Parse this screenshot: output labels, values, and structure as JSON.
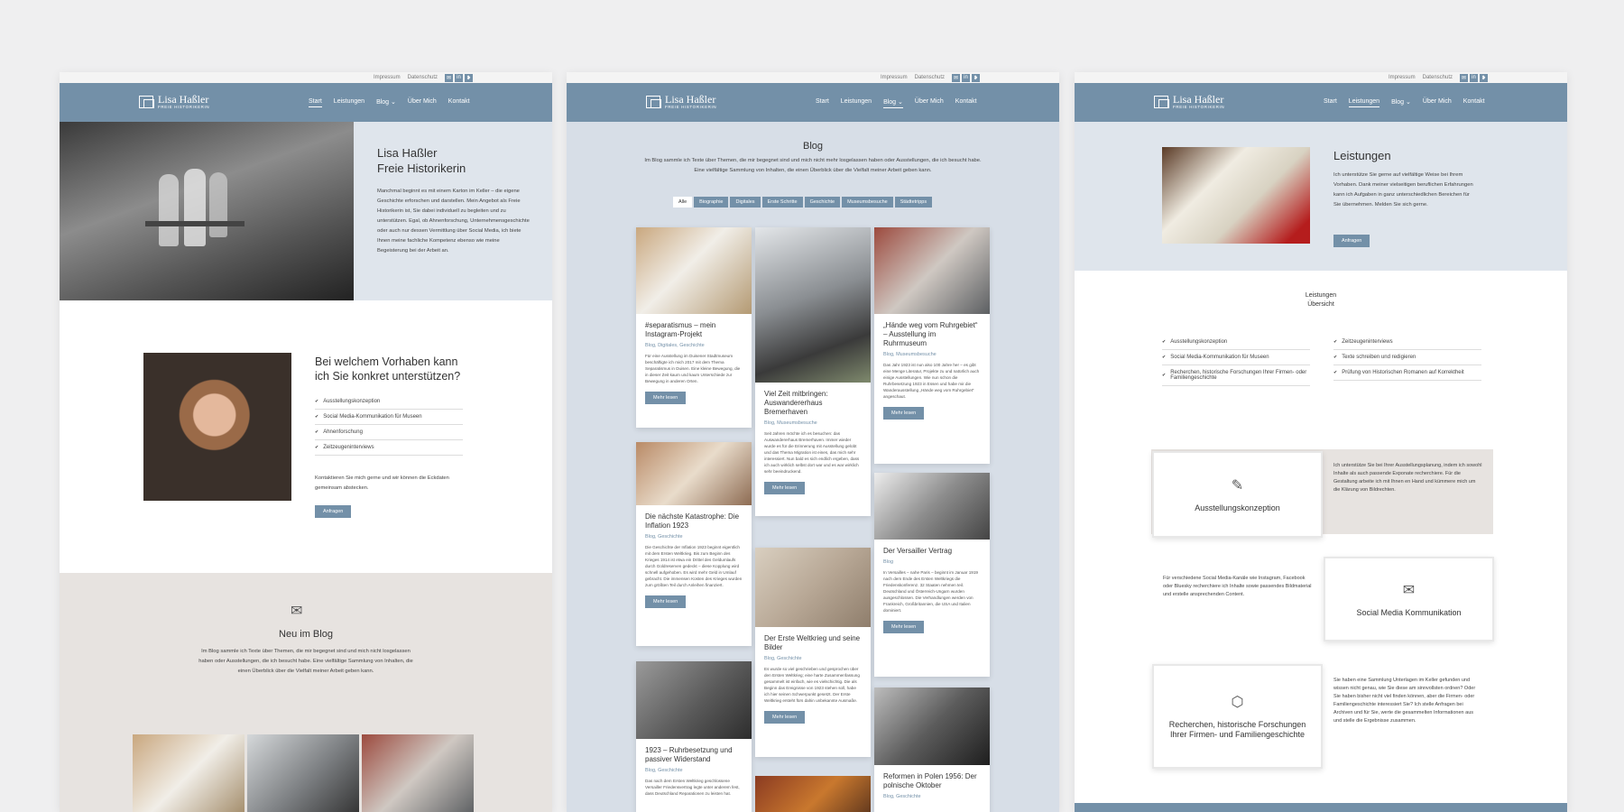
{
  "site": {
    "util": [
      "Impressum",
      "Datenschutz"
    ],
    "social": [
      "✉",
      "in",
      "❥"
    ],
    "logo_name": "Lisa Haßler",
    "logo_sub": "FREIE HISTORIKERIN",
    "menu": [
      "Start",
      "Leistungen",
      "Blog ⌄",
      "Über Mich",
      "Kontakt"
    ]
  },
  "start": {
    "hero_title1": "Lisa Haßler",
    "hero_title2": "Freie Historikerin",
    "hero_text": "Manchmal beginnt es mit einem Karton im Keller – die eigene Geschichte erforschen und darstellen. Mein Angebot als Freie Historikerin ist, Sie dabei individuell zu begleiten und zu unterstützen. Egal, ob Ahnenforschung, Unternehmensgeschichte oder auch nur dessen Vermittlung über Social Media, ich biete Ihnen meine fachliche Kompetenz ebenso wie meine Begeisterung bei der Arbeit an.",
    "q_title": "Bei welchem Vorhaben kann ich Sie konkret unterstützen?",
    "list": [
      "Ausstellungskonzeption",
      "Social Media-Kommunikation für Museen",
      "Ahnenforschung",
      "Zeitzeugeninterviews"
    ],
    "contact_text": "Kontaktieren Sie mich gerne und wir können die Eckdaten gemeinsam abstecken.",
    "btn": "Anfragen",
    "blog_title": "Neu im Blog",
    "blog_text": "Im Blog sammle ich Texte über Themen, die mir begegnet sind und mich nicht losgelassen haben oder Ausstellungen, die ich besucht habe. Eine vielfältige Sammlung von Inhalten, die einen Überblick über die Vielfalt meiner Arbeit geben kann."
  },
  "blog": {
    "title": "Blog",
    "intro": "Im Blog sammle ich Texte über Themen, die mir begegnet sind und mich nicht mehr losgelassen haben oder Ausstellungen, die ich besucht habe. Eine vielfältige Sammlung von Inhalten, die einen Überblick über die Vielfalt meiner Arbeit geben kann.",
    "filters": [
      "Alle",
      "Biographie",
      "Digitales",
      "Erste Schritte",
      "Geschichte",
      "Museumsbesuche",
      "Städtetripps"
    ],
    "more": "Mehr lesen",
    "cards": [
      {
        "title": "#separatismus – mein Instagram-Projekt",
        "cat": "Blog, Digitales, Geschichte",
        "text": "Für eine Ausstellung im Duisener Stadtmuseum beschäftigte ich mich 2017 mit dem Thema Separatismus in Duisen. Eine kleine Bewegung, die in dieser Zeit kaum und kaum Unterschiede zur Bewegung in anderen Orten."
      },
      {
        "title": "Die nächste Katastrophe: Die Inflation 1923",
        "cat": "Blog, Geschichte",
        "text": "Die Geschichte der Inflation 1923 beginnt eigentlich mit dem Ersten Weltkrieg. Bis zum Beginn des Krieges 1914 ist etwa ein Drittel des Geldumlaufs durch Goldreserven gedeckt – diese Kopplung wird schnell aufgehoben. Es wird mehr Geld in Umlauf gebracht. Die immensen Kosten des Krieges wurden zum größten Teil durch Anleihen finanziert."
      },
      {
        "title": "1923 – Ruhrbesetzung und passiver Widerstand",
        "cat": "Blog, Geschichte",
        "text": "Das nach dem Ersten Weltkrieg geschlossene Versailler Friedensvertrag legte unter anderem fest, dass Deutschland Reparationen zu leisten hat."
      },
      {
        "title": "Viel Zeit mitbringen: Auswandererhaus Bremerhaven",
        "cat": "Blog, Museumsbesuche",
        "text": "Seit Jahren möchte ich es besuchen: das Auswandererhaus Bremerhaven. Immer wieder wurde es für die Erinnerung mit Ausstellung gelobt und das Thema Migration ist eines, das mich sehr interessiert. Nun bald es sich endlich ergeben, dass ich auch wirklich selbst dort war und es war wirklich sehr beeindruckend."
      },
      {
        "title": "Der Erste Weltkrieg und seine Bilder",
        "cat": "Blog, Geschichte",
        "text": "Es wurde so viel geschrieben und gesprochen über den Ersten Weltkrieg; eine harte Zusammenfassung gesammelt ist einfach, wie es vielschichtig. Die als Beginn das Ereignisse von 1923 stehen soll, habe ich hier seinen Schwerpunkt gesetzt. Der Erste Weltkrieg ersteht fürs dahin unbekannte Ausmaße."
      },
      {
        "title": "„Hände weg vom Ruhrgebiet“ – Ausstellung im Ruhrmuseum",
        "cat": "Blog, Museumsbesuche",
        "text": "Das Jahr 1923 ist nun also 100 Jahre her – es gibt eine Menge Literatur, Projekte zu und natürlich auch einige Ausstellungen. Wie nun schon die Ruhrbesetzung 1923 in Essen und habe mir die Wanderausstellung „Hände weg vom Ruhrgebiet“ angeschaut."
      },
      {
        "title": "Der Versailler Vertrag",
        "cat": "Blog",
        "text": "In Versailles – nahe Paris – beginnt im Januar 1919 nach dem Ende des Ersten Weltkriegs die Friedenskonferenz. 32 Staaten nehmen teil. Deutschland und Österreich-Ungarn wurden ausgeschlossen. Die Verhandlungen werden von Frankreich, Großbritannien, die USA und Italien dominiert."
      },
      {
        "title": "Reformen in Polen 1956: Der polnische Oktober",
        "cat": "Blog, Geschichte",
        "text": ""
      }
    ]
  },
  "leistungen": {
    "title": "Leistungen",
    "text": "Ich unterstütze Sie gerne auf vielfältige Weise bei Ihrem Vorhaben. Dank meiner vielseitigen beruflichen Erfahrungen kann ich Aufgaben in ganz unterschiedlichen Bereichen für Sie übernehmen. Melden Sie sich gerne.",
    "btn": "Anfragen",
    "overview1": "Leistungen",
    "overview2": "Übersicht",
    "col1": [
      "Ausstellungskonzeption",
      "Social Media-Kommunikation für Museen",
      "Recherchen, historische Forschungen Ihrer Firmen- oder Familiengeschichte"
    ],
    "col2": [
      "Zeitzeugeninterviews",
      "Texte schreiben und redigieren",
      "Prüfung von Historischen Romanen auf Korrektheit"
    ],
    "svc": [
      {
        "title": "Ausstellungskonzeption",
        "icon": "✎",
        "text": "Ich unterstütze Sie bei Ihrer Ausstellungsplanung, indem ich sowohl Inhalte als auch passende Exponate recherchiere. Für die Gestaltung arbeite ich mit Ihnen en Hand und kümmere mich um die Klärung von Bildrechten."
      },
      {
        "title": "Social Media Kommunikation",
        "icon": "✉",
        "text": "Für verschiedene Social Media-Kanäle wie Instagram, Facebook oder Bluesky recherchiere ich Inhalte sowie passendes Bildmaterial und erstelle ansprechenden Content."
      },
      {
        "title": "Recherchen, historische Forschungen Ihrer Firmen- und Familiengeschichte",
        "icon": "⬡",
        "text": "Sie haben eine Sammlung Unterlagen im Keller gefunden und wissen nicht genau, wie Sie diese am sinnvollsten ordnen? Oder Sie haben bisher nicht viel finden können, aber die Firmen- oder Familiengeschichte interessiert Sie? Ich stelle Anfragen bei Archiven und für Sie, werte die gesammelten Informationen aus und stelle die Ergebnisse zusammen."
      }
    ]
  },
  "colors": {
    "nav": "#7390a8",
    "hero_bg": "#dfe5ec",
    "blog_bg": "#d7dee7",
    "beige": "#e7e3e0"
  }
}
